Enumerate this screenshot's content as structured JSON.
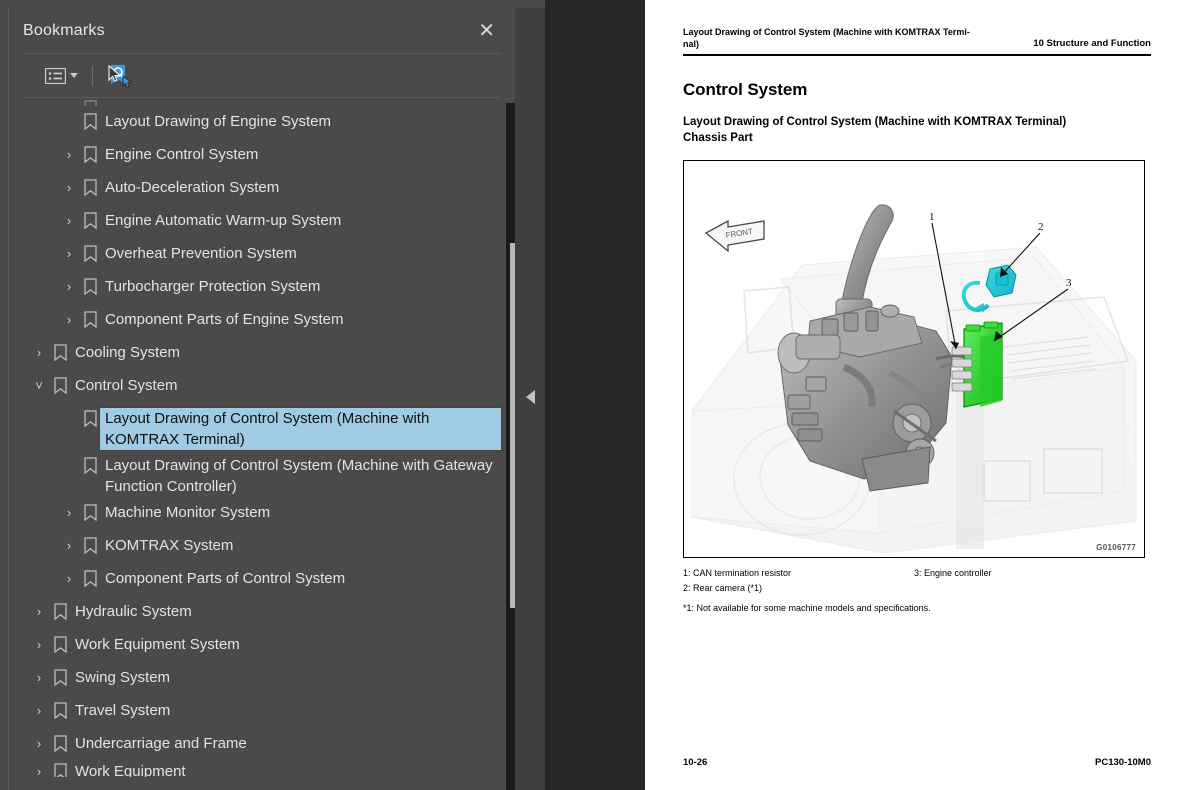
{
  "app": {
    "accent_selection": "#9fcbe4",
    "panel_bg": "#4a4a4a",
    "viewer_bg": "#262626"
  },
  "bookmarks_panel": {
    "title": "Bookmarks",
    "close_label": "✕",
    "toolbar": {
      "list_options_icon": "list-options-icon",
      "dropdown_caret": "chevron-down-icon",
      "find_bookmark_icon": "find-bookmark-icon"
    },
    "tree": [
      {
        "label": "",
        "indent": 2,
        "twisty": "",
        "partial": "top"
      },
      {
        "label": "Layout Drawing of Engine System",
        "indent": 2,
        "twisty": ""
      },
      {
        "label": "Engine Control System",
        "indent": 2,
        "twisty": "›"
      },
      {
        "label": "Auto-Deceleration System",
        "indent": 2,
        "twisty": "›"
      },
      {
        "label": "Engine Automatic Warm-up System",
        "indent": 2,
        "twisty": "›"
      },
      {
        "label": "Overheat Prevention System",
        "indent": 2,
        "twisty": "›"
      },
      {
        "label": "Turbocharger Protection System",
        "indent": 2,
        "twisty": "›"
      },
      {
        "label": "Component Parts of Engine System",
        "indent": 2,
        "twisty": "›"
      },
      {
        "label": "Cooling System",
        "indent": 1,
        "twisty": "›"
      },
      {
        "label": "Control System",
        "indent": 1,
        "twisty": "⌄",
        "expanded": true
      },
      {
        "label": "Layout Drawing of Control System (Machine with KOMTRAX Terminal)",
        "indent": 2,
        "twisty": "",
        "selected": true
      },
      {
        "label": "Layout Drawing of Control System (Machine with Gateway Function Controller)",
        "indent": 2,
        "twisty": ""
      },
      {
        "label": "Machine Monitor System",
        "indent": 2,
        "twisty": "›"
      },
      {
        "label": "KOMTRAX System",
        "indent": 2,
        "twisty": "›"
      },
      {
        "label": "Component Parts of Control System",
        "indent": 2,
        "twisty": "›"
      },
      {
        "label": "Hydraulic System",
        "indent": 1,
        "twisty": "›"
      },
      {
        "label": "Work Equipment System",
        "indent": 1,
        "twisty": "›"
      },
      {
        "label": "Swing System",
        "indent": 1,
        "twisty": "›"
      },
      {
        "label": "Travel System",
        "indent": 1,
        "twisty": "›"
      },
      {
        "label": "Undercarriage and Frame",
        "indent": 1,
        "twisty": "›"
      },
      {
        "label": "Work Equipment",
        "indent": 1,
        "twisty": "›",
        "partial": "bottom"
      }
    ]
  },
  "viewer": {
    "collapse_handle_icon": "triangle-left-icon"
  },
  "document": {
    "running_header_left": "Layout Drawing of Control System (Machine with KOMTRAX Termi-nal)",
    "running_header_right": "10 Structure and Function",
    "heading1": "Control System",
    "heading2_line1": "Layout Drawing of Control System (Machine with KOMTRAX Terminal)",
    "heading2_line2": "Chassis Part",
    "figure": {
      "code": "G0106777",
      "front_arrow_label": "FRONT",
      "callouts": [
        "1",
        "2",
        "3"
      ]
    },
    "legend": {
      "col1": [
        "1: CAN termination resistor",
        "2: Rear camera (*1)"
      ],
      "col2": [
        "3: Engine controller"
      ],
      "note": "*1: Not available for some machine models and specifications."
    },
    "footer_left": "10-26",
    "footer_right": "PC130-10M0"
  }
}
